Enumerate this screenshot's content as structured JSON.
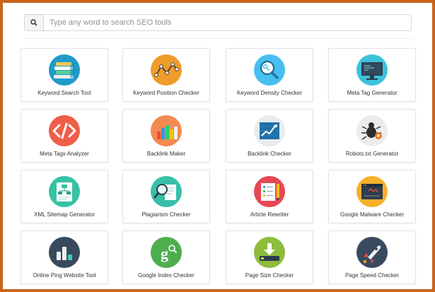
{
  "search": {
    "placeholder": "Type any word to search SEO tools",
    "icon": "search-icon"
  },
  "tools": [
    {
      "label": "Keyword Search Tool",
      "icon": "keyword-search-icon",
      "color": "#1f9bc9"
    },
    {
      "label": "Keyword Position Checker",
      "icon": "keyword-position-icon",
      "color": "#ef9c2b"
    },
    {
      "label": "Keyword Density Checker",
      "icon": "keyword-density-icon",
      "color": "#47bff0"
    },
    {
      "label": "Meta Tag Generator",
      "icon": "meta-tag-generator-icon",
      "color": "#3bc2db"
    },
    {
      "label": "Meta Tags Analyzer",
      "icon": "code-icon",
      "color": "#ef5e48"
    },
    {
      "label": "Backlink Maker",
      "icon": "backlink-maker-icon",
      "color": "#f38a52"
    },
    {
      "label": "Backlink Checker",
      "icon": "backlink-checker-icon",
      "color": "#e7ecef"
    },
    {
      "label": "Robots.txt Generator",
      "icon": "robot-bug-icon",
      "color": "#edeceb"
    },
    {
      "label": "XML Sitemap Generator",
      "icon": "sitemap-icon",
      "color": "#36c2a4"
    },
    {
      "label": "Plagiarism Checker",
      "icon": "plagiarism-icon",
      "color": "#37c0a8"
    },
    {
      "label": "Article Rewriter",
      "icon": "article-rewriter-icon",
      "color": "#e64854"
    },
    {
      "label": "Google Malware Checker",
      "icon": "malware-icon",
      "color": "#f6b02a"
    },
    {
      "label": "Online Ping Website Tool",
      "icon": "ping-icon",
      "color": "#3a4a5e"
    },
    {
      "label": "Google Index Checker",
      "icon": "google-index-icon",
      "color": "#4dae4f"
    },
    {
      "label": "Page Size Checker",
      "icon": "page-size-icon",
      "color": "#8dbd3b"
    },
    {
      "label": "Page Speed Checker",
      "icon": "page-speed-icon",
      "color": "#3a4a5e"
    }
  ]
}
